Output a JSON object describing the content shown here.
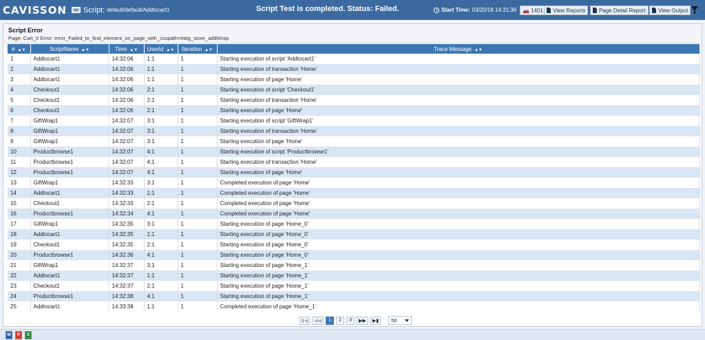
{
  "header": {
    "logo": "CAVISSON",
    "script_label": "Script:",
    "script_path": "default/default/Addtocart1",
    "status": "Script Test is completed. Status: Failed.",
    "start_time_label": "Start Time:",
    "start_time": "03/20/18 14:31:36",
    "session_id": "1401",
    "view_reports": "View Reports",
    "page_detail_report": "Page Detail Report",
    "view_output": "View Output"
  },
  "panel": {
    "title": "Script Error",
    "subtitle": "Page: Cart_0 Error: error_Failed_to_find_element_on_page_with_csspath=#atg_store_addWrap"
  },
  "table": {
    "columns": [
      "#",
      "ScriptName",
      "Time",
      "UserId",
      "Iteration",
      "Trace Message"
    ],
    "rows": [
      [
        "1",
        "Addtocart1",
        "14:32:06",
        "1:1",
        "1",
        "Starting execution of script 'Addtocart1'"
      ],
      [
        "2",
        "Addtocart1",
        "14:32:06",
        "1:1",
        "1",
        "Starting execution of transaction 'Home'"
      ],
      [
        "3",
        "Addtocart1",
        "14:32:06",
        "1:1",
        "1",
        "Starting execution of page 'Home'"
      ],
      [
        "4",
        "Checkout1",
        "14:32:06",
        "2:1",
        "1",
        "Starting execution of script 'Checkout1'"
      ],
      [
        "5",
        "Checkout1",
        "14:32:06",
        "2:1",
        "1",
        "Starting execution of transaction 'Home'"
      ],
      [
        "6",
        "Checkout1",
        "14:32:06",
        "2:1",
        "1",
        "Starting execution of page 'Home'"
      ],
      [
        "7",
        "GiftWrap1",
        "14:32:07",
        "3:1",
        "1",
        "Starting execution of script 'GiftWrap1'"
      ],
      [
        "8",
        "GiftWrap1",
        "14:32:07",
        "3:1",
        "1",
        "Starting execution of transaction 'Home'"
      ],
      [
        "9",
        "GiftWrap1",
        "14:32:07",
        "3:1",
        "1",
        "Starting execution of page 'Home'"
      ],
      [
        "10",
        "Productbrowse1",
        "14:32:07",
        "4:1",
        "1",
        "Starting execution of script 'Productbrowse1'"
      ],
      [
        "11",
        "Productbrowse1",
        "14:32:07",
        "4:1",
        "1",
        "Starting execution of transaction 'Home'"
      ],
      [
        "12",
        "Productbrowse1",
        "14:32:07",
        "4:1",
        "1",
        "Starting execution of page 'Home'"
      ],
      [
        "13",
        "GiftWrap1",
        "14:32:33",
        "3:1",
        "1",
        "Completed execution of page 'Home'"
      ],
      [
        "14",
        "Addtocart1",
        "14:32:33",
        "1:1",
        "1",
        "Completed execution of page 'Home'"
      ],
      [
        "15",
        "Checkout1",
        "14:32:33",
        "2:1",
        "1",
        "Completed execution of page 'Home'"
      ],
      [
        "16",
        "Productbrowse1",
        "14:32:34",
        "4:1",
        "1",
        "Completed execution of page 'Home'"
      ],
      [
        "17",
        "GiftWrap1",
        "14:32:35",
        "3:1",
        "1",
        "Starting execution of page 'Home_0'"
      ],
      [
        "18",
        "Addtocart1",
        "14:32:35",
        "1:1",
        "1",
        "Starting execution of page 'Home_0'"
      ],
      [
        "19",
        "Checkout1",
        "14:32:35",
        "2:1",
        "1",
        "Starting execution of page 'Home_0'"
      ],
      [
        "20",
        "Productbrowse1",
        "14:32:36",
        "4:1",
        "1",
        "Starting execution of page 'Home_0'"
      ],
      [
        "21",
        "GiftWrap1",
        "14:32:37",
        "3:1",
        "1",
        "Starting execution of page 'Home_1'"
      ],
      [
        "22",
        "Addtocart1",
        "14:32:37",
        "1:1",
        "1",
        "Starting execution of page 'Home_1'"
      ],
      [
        "23",
        "Checkout1",
        "14:32:37",
        "2:1",
        "1",
        "Starting execution of page 'Home_1'"
      ],
      [
        "24",
        "Productbrowse1",
        "14:32:38",
        "4:1",
        "1",
        "Starting execution of page 'Home_1'"
      ],
      [
        "25",
        "Addtocart1",
        "14:33:38",
        "1:1",
        "1",
        "Completed execution of page 'Home_1'"
      ]
    ]
  },
  "pager": {
    "pages": [
      "1",
      "2",
      "3"
    ],
    "current_page": "1",
    "page_size": "50"
  },
  "export_icons": [
    "word-export-icon",
    "pdf-export-icon",
    "excel-export-icon"
  ],
  "colors": {
    "header_bg": "#3b6aa0",
    "table_header_bg": "#3f77b4",
    "row_alt_bg": "#d9e6f4"
  }
}
